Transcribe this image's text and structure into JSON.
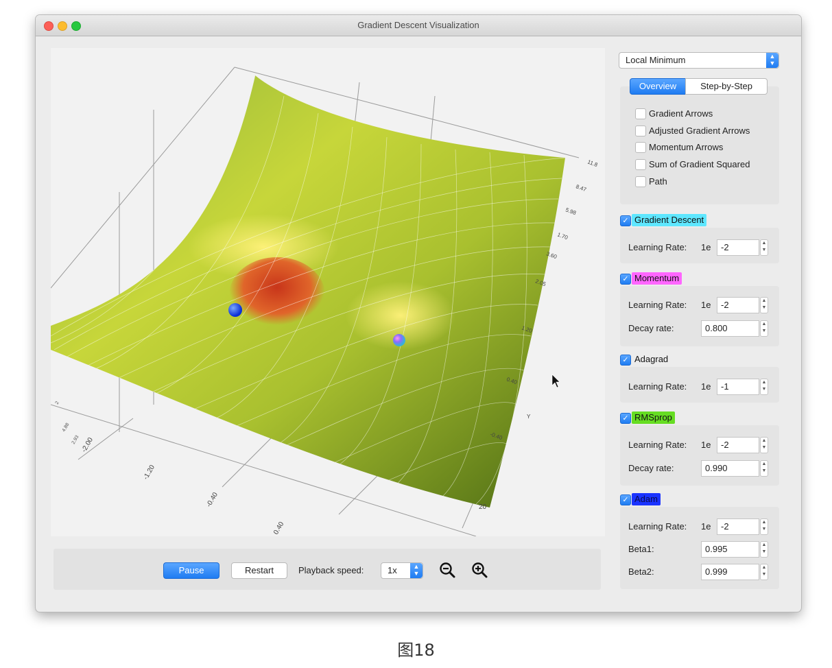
{
  "window": {
    "title": "Gradient Descent Visualization"
  },
  "scenario_select": {
    "value": "Local Minimum"
  },
  "tabs": {
    "overview": "Overview",
    "step_by_step": "Step-by-Step"
  },
  "display_options": [
    {
      "label": "Gradient Arrows",
      "checked": false
    },
    {
      "label": "Adjusted Gradient Arrows",
      "checked": false
    },
    {
      "label": "Momentum Arrows",
      "checked": false
    },
    {
      "label": "Sum of Gradient Squared",
      "checked": false
    },
    {
      "label": "Path",
      "checked": false
    }
  ],
  "optimizers": {
    "gd": {
      "name": "Gradient Descent",
      "color": "#5ee7ff",
      "lr_label": "Learning Rate:",
      "lr_prefix": "1e",
      "lr_value": "-2"
    },
    "momentum": {
      "name": "Momentum",
      "color": "#ff66ff",
      "lr_label": "Learning Rate:",
      "lr_prefix": "1e",
      "lr_value": "-2",
      "decay_label": "Decay rate:",
      "decay_value": "0.800"
    },
    "adagrad": {
      "name": "Adagrad",
      "color": "#ffffff",
      "lr_label": "Learning Rate:",
      "lr_prefix": "1e",
      "lr_value": "-1"
    },
    "rmsprop": {
      "name": "RMSprop",
      "color": "#66dd22",
      "lr_label": "Learning Rate:",
      "lr_prefix": "1e",
      "lr_value": "-2",
      "decay_label": "Decay rate:",
      "decay_value": "0.990"
    },
    "adam": {
      "name": "Adam",
      "color": "#1a33ff",
      "lr_label": "Learning Rate:",
      "lr_prefix": "1e",
      "lr_value": "-2",
      "beta1_label": "Beta1:",
      "beta1_value": "0.995",
      "beta2_label": "Beta2:",
      "beta2_value": "0.999"
    }
  },
  "controls": {
    "pause": "Pause",
    "restart": "Restart",
    "speed_label": "Playback speed:",
    "speed_value": "1x"
  },
  "axes": {
    "right_ticks": [
      "11.8",
      "8.47",
      "5.98",
      "1.70",
      "3.60",
      "2.05",
      "1.20",
      "0.40",
      "-0.40",
      "20"
    ],
    "bottom_ticks": [
      "-2.00",
      "-1.20",
      "-0.40",
      "0.40"
    ],
    "left_ticks": [
      "2",
      "4.88",
      "2.93"
    ],
    "right_axis_letter": "Y"
  },
  "caption": "图18"
}
